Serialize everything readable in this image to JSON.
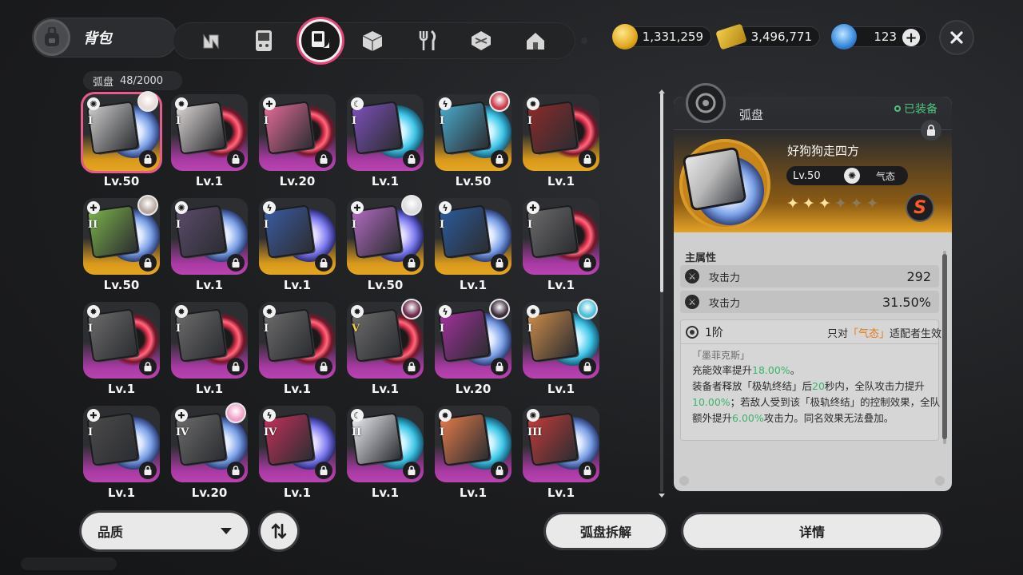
{
  "header": {
    "title": "背包",
    "tabs": [
      "drive-tab",
      "console-tab",
      "disc-tab",
      "box-tab",
      "food-tab",
      "material-tab",
      "home-tab"
    ],
    "active_tab": "disc-tab"
  },
  "currencies": [
    {
      "icon": "coin-icon",
      "value": "1,331,259"
    },
    {
      "icon": "ticket-icon",
      "value": "3,496,771"
    },
    {
      "icon": "energy-icon",
      "value": "123"
    }
  ],
  "inventory": {
    "category": "弧盘",
    "count": "48/2000"
  },
  "cards": [
    {
      "q": "s",
      "lv": "Lv.50",
      "tier": "I",
      "elem": "✺",
      "disc": "blue",
      "cover": "#c9c9c9",
      "avatar": "#e9dcd8",
      "sel": true
    },
    {
      "q": "a",
      "lv": "Lv.1",
      "tier": "I",
      "elem": "✹",
      "disc": "red",
      "cover": "#d7d2d0",
      "avatar": ""
    },
    {
      "q": "a",
      "lv": "Lv.20",
      "tier": "I",
      "elem": "✚",
      "disc": "red",
      "cover": "#e06a96",
      "avatar": ""
    },
    {
      "q": "a",
      "lv": "Lv.1",
      "tier": "I",
      "elem": "☾",
      "disc": "cyan",
      "cover": "#7b4fb8",
      "avatar": ""
    },
    {
      "q": "s",
      "lv": "Lv.50",
      "tier": "I",
      "elem": "ϟ",
      "disc": "cyan",
      "cover": "#4aa7c9",
      "avatar": "#c83a4a"
    },
    {
      "q": "s",
      "lv": "Lv.1",
      "tier": "I",
      "elem": "✹",
      "disc": "red",
      "cover": "#8a2a2a",
      "avatar": ""
    },
    {
      "q": "s",
      "lv": "Lv.50",
      "tier": "II",
      "elem": "✚",
      "disc": "blue",
      "cover": "#7ab04a",
      "avatar": "#b8a8a0"
    },
    {
      "q": "a",
      "lv": "Lv.1",
      "tier": "I",
      "elem": "✺",
      "disc": "blue",
      "cover": "#5a4a6a",
      "avatar": ""
    },
    {
      "q": "s",
      "lv": "Lv.1",
      "tier": "I",
      "elem": "ϟ",
      "disc": "violet",
      "cover": "#3a5aa0",
      "avatar": ""
    },
    {
      "q": "s",
      "lv": "Lv.50",
      "tier": "I",
      "elem": "✚",
      "disc": "violet",
      "cover": "#b06ac0",
      "avatar": "#dcdcdc"
    },
    {
      "q": "s",
      "lv": "Lv.1",
      "tier": "I",
      "elem": "ϟ",
      "disc": "blue",
      "cover": "#2a5a9a",
      "avatar": ""
    },
    {
      "q": "a",
      "lv": "Lv.1",
      "tier": "I",
      "elem": "✚",
      "disc": "red",
      "cover": "#6a6a6a",
      "avatar": ""
    },
    {
      "q": "a",
      "lv": "Lv.1",
      "tier": "I",
      "elem": "✹",
      "disc": "red",
      "cover": "#6a6a6a",
      "avatar": ""
    },
    {
      "q": "a",
      "lv": "Lv.1",
      "tier": "I",
      "elem": "✹",
      "disc": "red",
      "cover": "#6a6a6a",
      "avatar": ""
    },
    {
      "q": "a",
      "lv": "Lv.1",
      "tier": "I",
      "elem": "✹",
      "disc": "red",
      "cover": "#6a6a6a",
      "avatar": ""
    },
    {
      "q": "a",
      "lv": "Lv.1",
      "tier": "V",
      "elem": "✹",
      "disc": "red",
      "cover": "#6a6a6a",
      "avatar": "#6a2a4a",
      "gold": true
    },
    {
      "q": "a",
      "lv": "Lv.20",
      "tier": "I",
      "elem": "ϟ",
      "disc": "blue",
      "cover": "#a0309a",
      "avatar": "#3a2a3a"
    },
    {
      "q": "a",
      "lv": "Lv.1",
      "tier": "I",
      "elem": "✹",
      "disc": "cyan",
      "cover": "#c98a4a",
      "avatar": "#4ac0d8"
    },
    {
      "q": "a",
      "lv": "Lv.1",
      "tier": "I",
      "elem": "✚",
      "disc": "blue",
      "cover": "#4a4a4a",
      "avatar": ""
    },
    {
      "q": "a",
      "lv": "Lv.20",
      "tier": "IV",
      "elem": "✚",
      "disc": "blue",
      "cover": "#6a6a6a",
      "avatar": "#f0a0c8"
    },
    {
      "q": "a",
      "lv": "Lv.1",
      "tier": "IV",
      "elem": "ϟ",
      "disc": "violet",
      "cover": "#c0305a",
      "avatar": ""
    },
    {
      "q": "a",
      "lv": "Lv.1",
      "tier": "II",
      "elem": "☾",
      "disc": "cyan",
      "cover": "#e8e8f0",
      "avatar": ""
    },
    {
      "q": "a",
      "lv": "Lv.1",
      "tier": "I",
      "elem": "✹",
      "disc": "cyan",
      "cover": "#e07a4a",
      "avatar": ""
    },
    {
      "q": "a",
      "lv": "Lv.1",
      "tier": "III",
      "elem": "✺",
      "disc": "blue",
      "cover": "#c03a3a",
      "avatar": ""
    }
  ],
  "detail": {
    "category": "弧盘",
    "equipped": "已装备",
    "name": "好狗狗走四方",
    "level": "Lv.50",
    "element": "气态",
    "rank": "S",
    "stars_lit": 3,
    "stars_total": 6,
    "main_attr_title": "主属性",
    "stats": [
      {
        "name": "攻击力",
        "value": "292"
      },
      {
        "name": "攻击力",
        "value": "31.50%"
      }
    ],
    "effect": {
      "stage": "1阶",
      "only_for_prefix": "只对",
      "only_for_elem": "「气态」",
      "only_for_suffix": "适配者生效",
      "set_name": "「墨菲克斯」",
      "text_html": "充能效率提升<span class=\"g\">18.00%</span>。<br>装备者释放「极轨终结」后<span class=\"g\">20</span>秒内，全队攻击力提升<span class=\"g\">10.00%</span>；若敌人受到该「极轨终结」的控制效果，全队额外提升<span class=\"g\">6.00%</span>攻击力。同名效果无法叠加。"
    }
  },
  "buttons": {
    "sort": "品质",
    "dismantle": "弧盘拆解",
    "details": "详情"
  }
}
